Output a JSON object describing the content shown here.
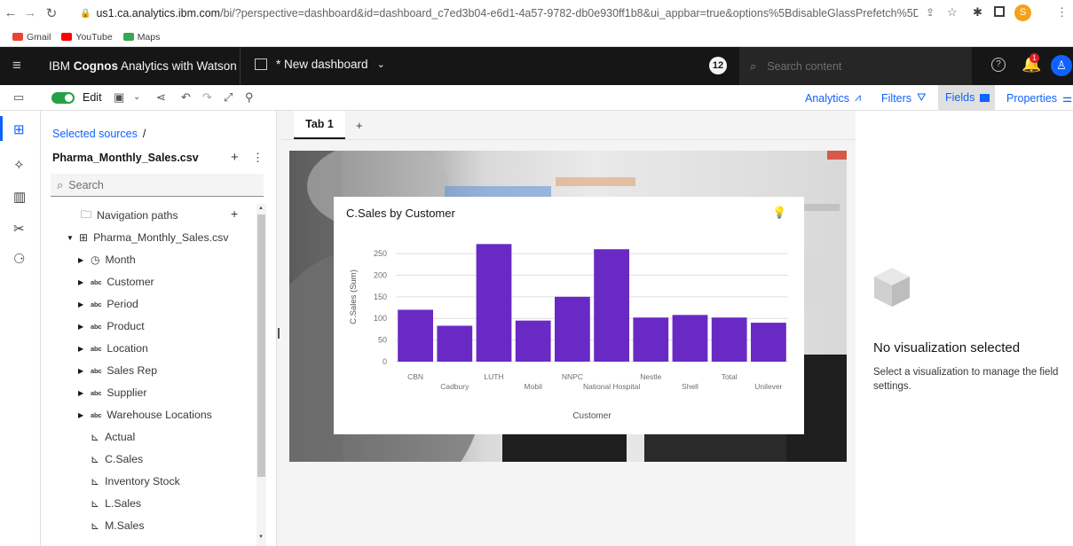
{
  "browser": {
    "url_host": "us1.ca.analytics.ibm.com",
    "url_path": "/bi/?perspective=dashboard&id=dashboard_c7ed3b04-e6d1-4a57-9782-db0e930ff1b8&ui_appbar=true&options%5BdisableGlassPrefetch%5D=true&options%5Bcol...",
    "profile_initial": "S",
    "bookmarks": [
      {
        "label": "Gmail",
        "color": "#ea4335"
      },
      {
        "label": "YouTube",
        "color": "#ff0000"
      },
      {
        "label": "Maps",
        "color": "#34a853"
      }
    ]
  },
  "appbar": {
    "brand_prefix": "IBM ",
    "brand_bold": "Cognos",
    "brand_suffix": " Analytics with Watson",
    "dashboard_title": "* New dashboard",
    "notif_count": "12",
    "search_placeholder": "Search content",
    "bell_count": "1"
  },
  "toolbar": {
    "edit_label": "Edit",
    "analytics_label": "Analytics",
    "filters_label": "Filters",
    "fields_label": "Fields",
    "properties_label": "Properties"
  },
  "panel": {
    "breadcrumb": "Selected sources",
    "breadcrumb_sep": "/",
    "source_name": "Pharma_Monthly_Sales.csv",
    "search_placeholder": "Search",
    "nav_paths": "Navigation paths",
    "table_name": "Pharma_Monthly_Sales.csv",
    "fields": [
      {
        "label": "Month",
        "kind": "time"
      },
      {
        "label": "Customer",
        "kind": "abc"
      },
      {
        "label": "Period",
        "kind": "abc"
      },
      {
        "label": "Product",
        "kind": "abc"
      },
      {
        "label": "Location",
        "kind": "abc"
      },
      {
        "label": "Sales Rep",
        "kind": "abc"
      },
      {
        "label": "Supplier",
        "kind": "abc"
      },
      {
        "label": "Warehouse Locations",
        "kind": "abc"
      },
      {
        "label": "Actual",
        "kind": "measure"
      },
      {
        "label": "C.Sales",
        "kind": "measure"
      },
      {
        "label": "Inventory Stock",
        "kind": "measure"
      },
      {
        "label": "L.Sales",
        "kind": "measure"
      },
      {
        "label": "M.Sales",
        "kind": "measure"
      }
    ]
  },
  "canvas": {
    "tab_label": "Tab 1",
    "viz_title": "C.Sales by Customer"
  },
  "right_panel": {
    "title": "No visualization selected",
    "description": "Select a visualization to manage the field settings."
  },
  "colors": {
    "accent": "#0f62fe",
    "bar": "#6929c4",
    "header_bg": "#161616",
    "toggle_on": "#24a148"
  },
  "chart_data": {
    "type": "bar",
    "title": "C.Sales by Customer",
    "xlabel": "Customer",
    "ylabel": "C.Sales (Sum)",
    "categories": [
      "CBN",
      "Cadbury",
      "LUTH",
      "Mobil",
      "NNPC",
      "National Hospital",
      "Nestle",
      "Shell",
      "Total",
      "Unilever"
    ],
    "values": [
      120,
      83,
      272,
      95,
      150,
      260,
      102,
      108,
      102,
      90
    ],
    "yticks": [
      0,
      50,
      100,
      150,
      200,
      250
    ],
    "ylim": [
      0,
      285
    ],
    "grid": true,
    "legend": "none"
  }
}
